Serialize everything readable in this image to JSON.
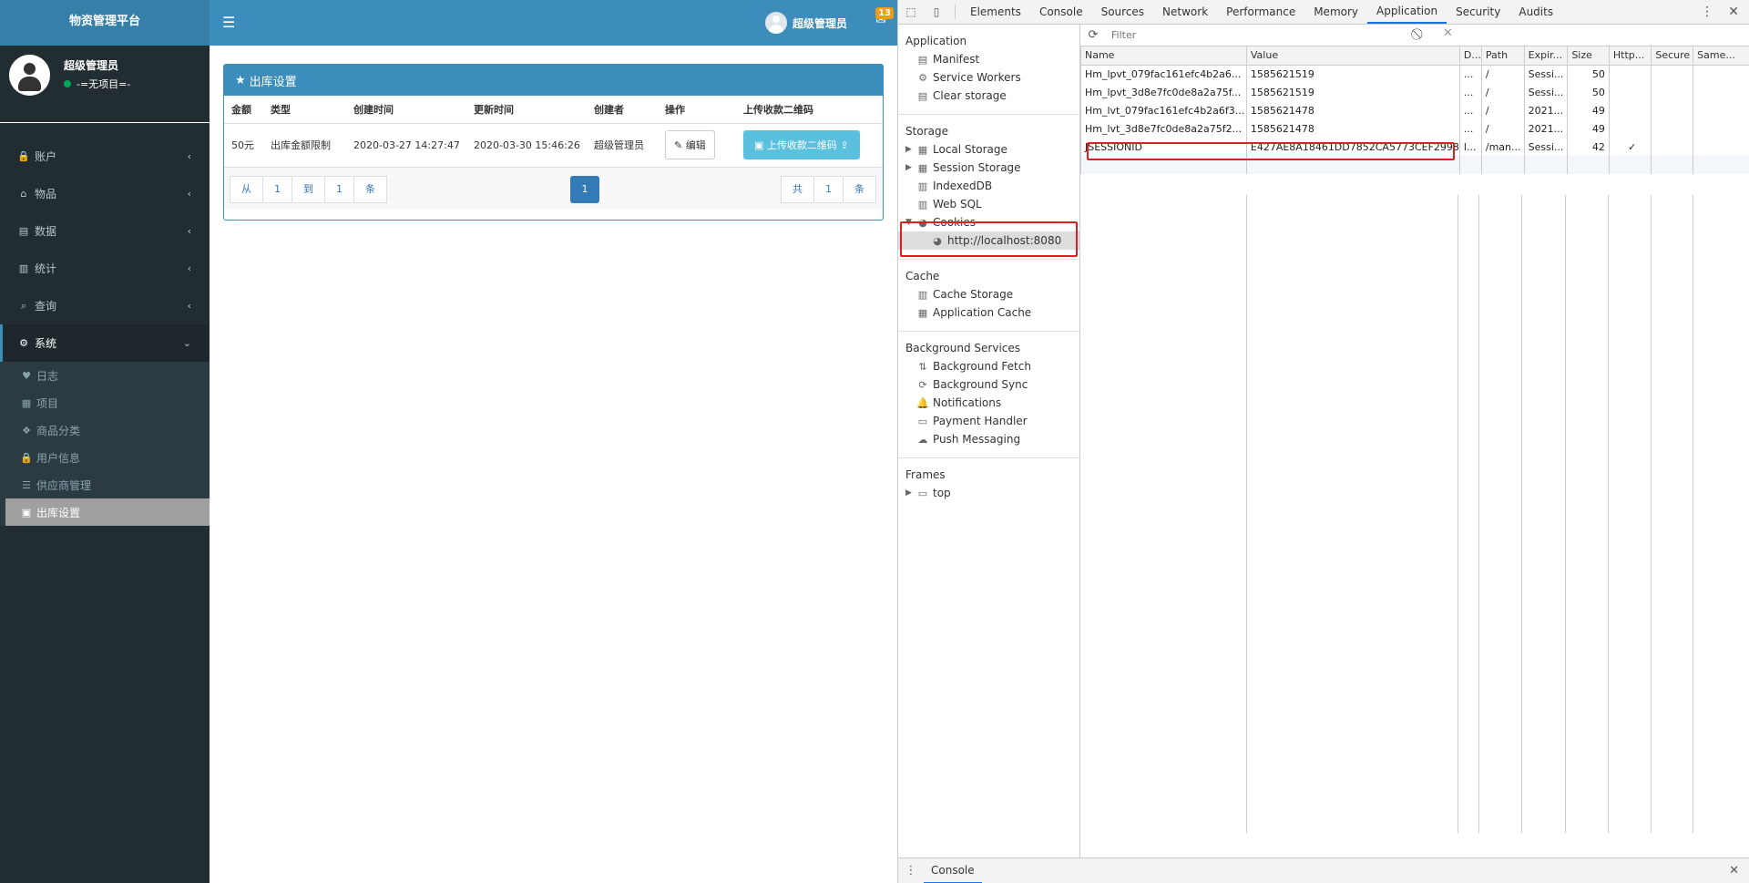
{
  "app": {
    "brand": "物资管理平台",
    "user_name": "超级管理员",
    "notification_count": "13"
  },
  "sidebar": {
    "user": {
      "name": "超级管理员",
      "status": "-=无项目=-"
    },
    "menu": [
      {
        "label": "账户",
        "icon": "lock-icon",
        "glyph": "🔒"
      },
      {
        "label": "物品",
        "icon": "tag-icon",
        "glyph": "⌂"
      },
      {
        "label": "数据",
        "icon": "database-icon",
        "glyph": "▤"
      },
      {
        "label": "统计",
        "icon": "bar-chart-icon",
        "glyph": "▥"
      },
      {
        "label": "查询",
        "icon": "search-icon",
        "glyph": "⌕"
      },
      {
        "label": "系统",
        "icon": "gears-icon",
        "glyph": "⚙"
      }
    ],
    "submenu": [
      {
        "label": "日志",
        "icon": "heartbeat-icon",
        "glyph": "♥"
      },
      {
        "label": "项目",
        "icon": "building-icon",
        "glyph": "▦"
      },
      {
        "label": "商品分类",
        "icon": "cubes-icon",
        "glyph": "❖"
      },
      {
        "label": "用户信息",
        "icon": "user-lock-icon",
        "glyph": "🔒"
      },
      {
        "label": "供应商管理",
        "icon": "list-icon",
        "glyph": "☰"
      },
      {
        "label": "出库设置",
        "icon": "money-icon",
        "glyph": "▣"
      }
    ]
  },
  "panel": {
    "title": "出库设置",
    "columns": [
      "金额",
      "类型",
      "创建时间",
      "更新时间",
      "创建者",
      "操作",
      "上传收款二维码"
    ],
    "rows": [
      [
        "50元",
        "出库金额限制",
        "2020-03-27 14:27:47",
        "2020-03-30 15:46:26",
        "超级管理员"
      ]
    ],
    "edit_label": "编辑",
    "upload_label": "上传收款二维码",
    "pager_left": [
      "从",
      "1",
      "到",
      "1",
      "条"
    ],
    "pager_current": "1",
    "pager_right": [
      "共",
      "1",
      "条"
    ]
  },
  "devtools": {
    "tabs": [
      "Elements",
      "Console",
      "Sources",
      "Network",
      "Performance",
      "Memory",
      "Application",
      "Security",
      "Audits"
    ],
    "active_tab": "Application",
    "sections": {
      "application": {
        "title": "Application",
        "items": [
          "Manifest",
          "Service Workers",
          "Clear storage"
        ]
      },
      "storage": {
        "title": "Storage",
        "items": [
          "Local Storage",
          "Session Storage",
          "IndexedDB",
          "Web SQL",
          "Cookies"
        ],
        "cookie_origin": "http://localhost:8080"
      },
      "cache": {
        "title": "Cache",
        "items": [
          "Cache Storage",
          "Application Cache"
        ]
      },
      "background": {
        "title": "Background Services",
        "items": [
          "Background Fetch",
          "Background Sync",
          "Notifications",
          "Payment Handler",
          "Push Messaging"
        ]
      },
      "frames": {
        "title": "Frames",
        "items": [
          "top"
        ]
      }
    },
    "filter_placeholder": "Filter",
    "cookie_columns": [
      "Name",
      "Value",
      "D...",
      "Path",
      "Expir...",
      "Size",
      "Http...",
      "Secure",
      "Same..."
    ],
    "cookies": [
      [
        "Hm_lpvt_079fac161efc4b2a6...",
        "1585621519",
        "...",
        "/",
        "Sessi...",
        "50",
        "",
        "",
        ""
      ],
      [
        "Hm_lpvt_3d8e7fc0de8a2a75f...",
        "1585621519",
        "...",
        "/",
        "Sessi...",
        "50",
        "",
        "",
        ""
      ],
      [
        "Hm_lvt_079fac161efc4b2a6f3...",
        "1585621478",
        "...",
        "/",
        "2021...",
        "49",
        "",
        "",
        ""
      ],
      [
        "Hm_lvt_3d8e7fc0de8a2a75f2...",
        "1585621478",
        "...",
        "/",
        "2021...",
        "49",
        "",
        "",
        ""
      ],
      [
        "JSESSIONID",
        "E427AE8A18461DD7852CA5773CEF2998",
        "l...",
        "/man...",
        "Sessi...",
        "42",
        "✓",
        "",
        ""
      ]
    ],
    "drawer_tab": "Console",
    "highlight_color": "#e02020"
  }
}
